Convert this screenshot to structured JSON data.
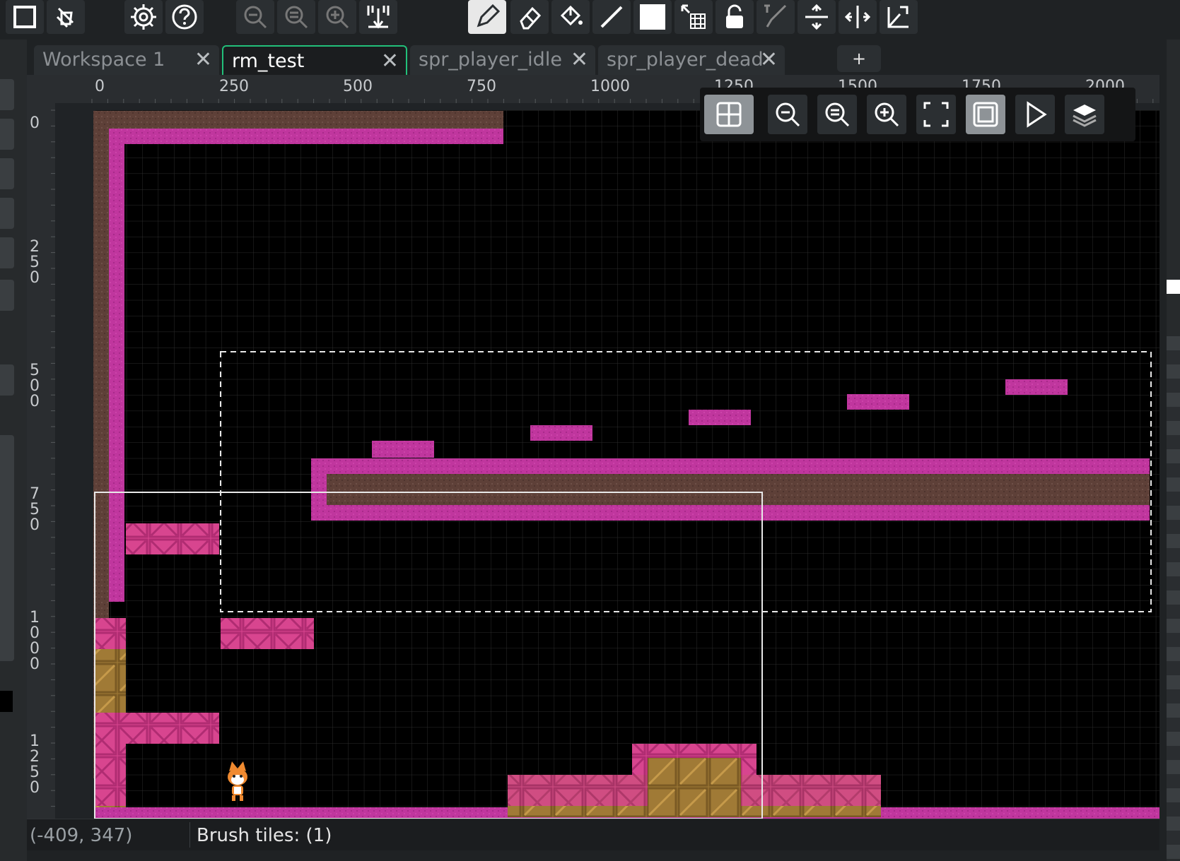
{
  "toolbar": {
    "buttons": [
      {
        "name": "new-room-icon"
      },
      {
        "name": "clear-brush-icon"
      },
      {
        "name": "settings-icon"
      },
      {
        "name": "help-icon"
      },
      {
        "name": "zoom-out-icon"
      },
      {
        "name": "zoom-reset-icon"
      },
      {
        "name": "zoom-in-icon"
      },
      {
        "name": "grid-snap-icon"
      },
      {
        "name": "pencil-icon"
      },
      {
        "name": "eraser-icon"
      },
      {
        "name": "fill-bucket-icon"
      },
      {
        "name": "line-icon"
      },
      {
        "name": "rectangle-icon"
      },
      {
        "name": "select-tiles-icon"
      },
      {
        "name": "lock-icon"
      },
      {
        "name": "brush-picker-icon"
      },
      {
        "name": "flip-vertical-icon"
      },
      {
        "name": "flip-horizontal-icon"
      },
      {
        "name": "rotate-icon"
      }
    ],
    "active_tool": "pencil-icon"
  },
  "tabs": [
    {
      "label": "Workspace 1",
      "active": false
    },
    {
      "label": "rm_test",
      "active": true
    },
    {
      "label": "spr_player_idle",
      "active": false
    },
    {
      "label": "spr_player_dead",
      "active": false
    }
  ],
  "tab_add_label": "+",
  "tab_close_glyph": "✕",
  "ruler": {
    "top": [
      "0",
      "250",
      "500",
      "750",
      "1000",
      "1250",
      "1500",
      "1750",
      "2000"
    ],
    "left": [
      "0",
      "250",
      "500",
      "750",
      "1000",
      "1250"
    ]
  },
  "view_toolbar": {
    "buttons": [
      "grid-toggle-icon",
      "zoom-out-icon",
      "zoom-reset-icon",
      "zoom-in-icon",
      "fit-room-icon",
      "view-bounds-icon",
      "play-icon",
      "layers-icon"
    ]
  },
  "colors": {
    "magenta": "#c0369e",
    "brown": "#5e4038",
    "crate_pink": "#d8458f",
    "crate_gold": "#a07a36",
    "canvas": "#000000",
    "accent": "#22c07a"
  },
  "status": {
    "coords": "(-409, 347)",
    "brush": "Brush tiles: (1)"
  }
}
